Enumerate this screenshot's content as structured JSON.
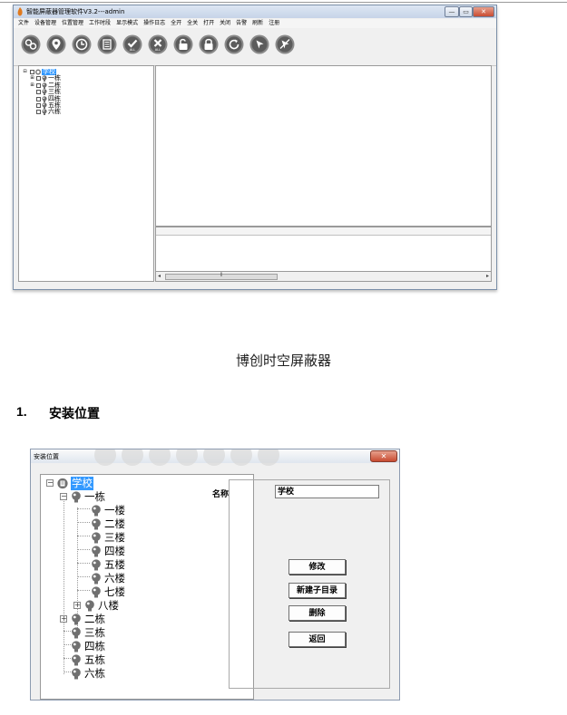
{
  "app": {
    "title": "智能屏蔽器管理软件V3.2---admin",
    "window_buttons": {
      "minimize": "—",
      "maximize": "▭",
      "close": "✕"
    }
  },
  "menu": [
    "文件",
    "设备管理",
    "位置管理",
    "工作时段",
    "显示模式",
    "操作日志",
    "全开",
    "全关",
    "打开",
    "关闭",
    "告警",
    "刷新",
    "注册"
  ],
  "toolbar": {
    "tools": [
      {
        "icon": "devices-icon"
      },
      {
        "icon": "location-pin-icon"
      },
      {
        "icon": "clock-icon"
      },
      {
        "icon": "list-icon"
      },
      {
        "icon": "check-all-icon",
        "label": "ALL"
      },
      {
        "icon": "close-all-icon",
        "label": "ALL"
      },
      {
        "icon": "unlock-icon"
      },
      {
        "icon": "lock-icon"
      },
      {
        "icon": "refresh-icon"
      },
      {
        "icon": "select-cursor-icon"
      },
      {
        "icon": "cancel-cursor-icon"
      }
    ],
    "colors": {
      "outer": "#8a8a8a",
      "inner": "#5c5c5c",
      "glyph": "#ffffff"
    }
  },
  "tree": {
    "root": "学校",
    "nodes": [
      "一栋",
      "二栋",
      "三栋",
      "四栋",
      "五栋",
      "六栋"
    ]
  },
  "scrollbar": {
    "left_arrow": "◂",
    "right_arrow": "▸",
    "grip": "⦀"
  },
  "doc": {
    "title": "博创时空屏蔽器",
    "section_number": "1.",
    "section_title": "安装位置"
  },
  "dialog": {
    "title": "安装位置",
    "close": "✕",
    "tree": {
      "root": "学校",
      "building": "一栋",
      "floors": [
        "一楼",
        "二楼",
        "三楼",
        "四楼",
        "五楼",
        "六楼",
        "七楼",
        "八楼"
      ],
      "others": [
        "二栋",
        "三栋",
        "四栋",
        "五栋",
        "六栋"
      ]
    },
    "name_label": "名称",
    "name_value": "学校",
    "buttons": {
      "modify": "修改",
      "new_subdir": "新建子目录",
      "delete": "删除",
      "back": "返回"
    }
  },
  "colors": {
    "selection": "#3399ff",
    "bulb": "#707070"
  }
}
